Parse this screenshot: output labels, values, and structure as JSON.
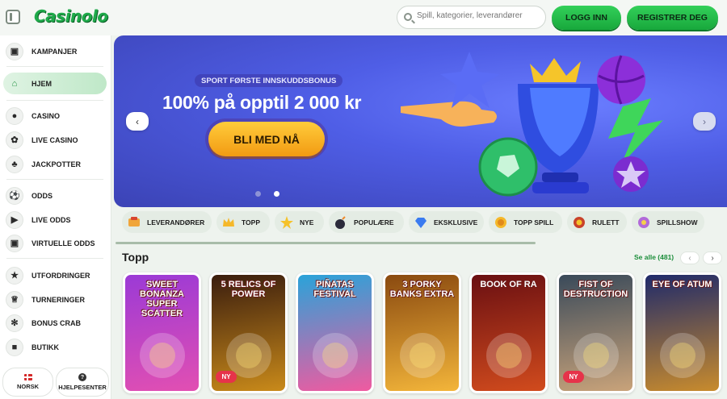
{
  "header": {
    "logo": "Casinolo",
    "search_placeholder": "Spill, kategorier, leverandører",
    "login_label": "LOGG INN",
    "register_label": "REGISTRER DEG"
  },
  "sidebar": {
    "items": [
      {
        "label": "KAMPANJER",
        "icon": "gift-icon"
      },
      {
        "label": "HJEM",
        "icon": "home-icon",
        "active": true
      },
      {
        "label": "CASINO",
        "icon": "casino-chip-icon"
      },
      {
        "label": "LIVE CASINO",
        "icon": "roulette-icon"
      },
      {
        "label": "JACKPOTTER",
        "icon": "clover-icon"
      },
      {
        "label": "ODDS",
        "icon": "soccer-ball-icon"
      },
      {
        "label": "LIVE ODDS",
        "icon": "live-tv-icon"
      },
      {
        "label": "VIRTUELLE ODDS",
        "icon": "virtual-screen-icon"
      },
      {
        "label": "UTFORDRINGER",
        "icon": "star-icon"
      },
      {
        "label": "TURNERINGER",
        "icon": "trophy-icon"
      },
      {
        "label": "BONUS CRAB",
        "icon": "crab-icon"
      },
      {
        "label": "BUTIKK",
        "icon": "shop-bag-icon"
      }
    ],
    "language_label": "NORSK",
    "help_label": "HJELPESENTER"
  },
  "banner": {
    "subtitle": "SPORT FØRSTE INNSKUDDSBONUS",
    "title": "100% på opptil 2 000 kr",
    "cta": "BLI MED NÅ",
    "slide_count": 2,
    "active_slide": 2
  },
  "categories": [
    {
      "label": "LEVERANDØRER",
      "icon": "providers-icon"
    },
    {
      "label": "TOPP",
      "icon": "crown-icon"
    },
    {
      "label": "NYE",
      "icon": "new-star-icon"
    },
    {
      "label": "POPULÆRE",
      "icon": "bomb-icon"
    },
    {
      "label": "EKSKLUSIVE",
      "icon": "diamond-icon"
    },
    {
      "label": "TOPP SPILL",
      "icon": "medal-icon"
    },
    {
      "label": "RULETT",
      "icon": "roulette-wheel-icon"
    },
    {
      "label": "SPILLSHOW",
      "icon": "gameshow-icon"
    }
  ],
  "games_section": {
    "title": "Topp",
    "see_all": "Se alle (481)",
    "new_label": "NY",
    "games": [
      {
        "name": "SWEET BONANZA SUPER SCATTER",
        "colors": [
          "#9b3ad6",
          "#e24fb2"
        ],
        "new": false
      },
      {
        "name": "5 RELICS OF POWER",
        "colors": [
          "#3a1d0e",
          "#c98a1a"
        ],
        "new": true
      },
      {
        "name": "PIÑATAS FESTIVAL",
        "colors": [
          "#2aa3d9",
          "#f05aa0"
        ],
        "new": false
      },
      {
        "name": "3 PORKY BANKS EXTRA",
        "colors": [
          "#8a4a10",
          "#f3b53a"
        ],
        "new": false
      },
      {
        "name": "BOOK OF RA",
        "colors": [
          "#6a0f12",
          "#d14b1d"
        ],
        "new": false
      },
      {
        "name": "FIST OF DESTRUCTION",
        "colors": [
          "#3a4a5a",
          "#c9a37a"
        ],
        "new": true
      },
      {
        "name": "EYE OF ATUM",
        "colors": [
          "#1f2a6a",
          "#c88b2d"
        ],
        "new": false
      }
    ]
  }
}
